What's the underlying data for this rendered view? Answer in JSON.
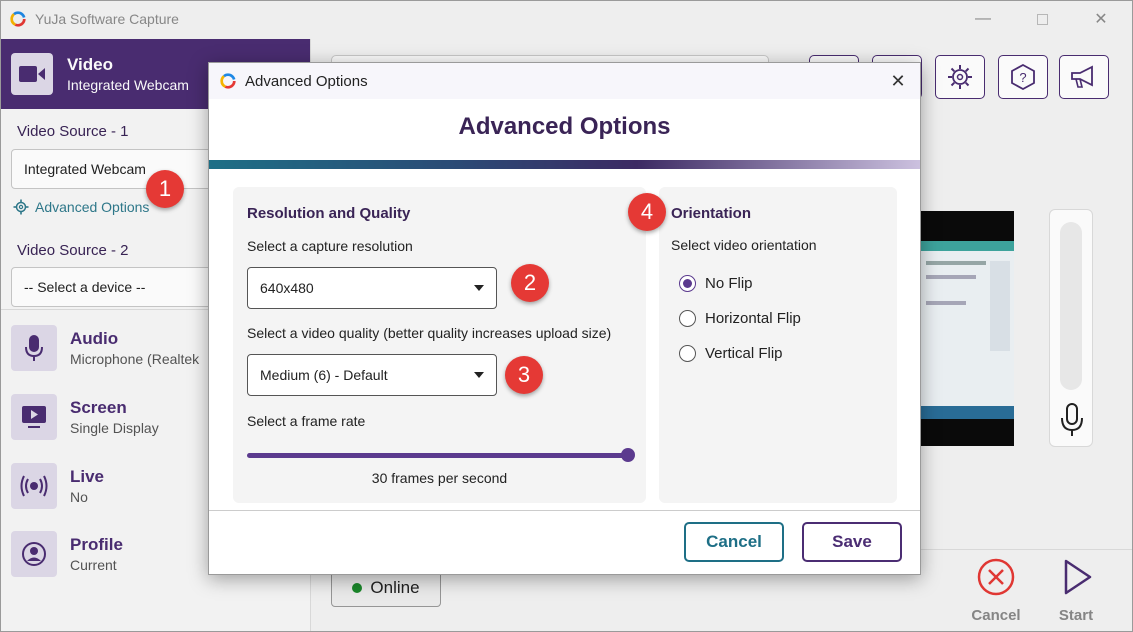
{
  "app": {
    "title": "YuJa Software Capture"
  },
  "sidebar": {
    "video": {
      "title": "Video",
      "subtitle": "Integrated Webcam"
    },
    "source1": {
      "label": "Video Source - 1",
      "value": "Integrated Webcam"
    },
    "advanced_link": "Advanced Options",
    "source2": {
      "label": "Video Source - 2",
      "value": "-- Select a device --"
    },
    "items": [
      {
        "title": "Audio",
        "subtitle": "Microphone (Realtek"
      },
      {
        "title": "Screen",
        "subtitle": "Single Display"
      },
      {
        "title": "Live",
        "subtitle": "No"
      },
      {
        "title": "Profile",
        "subtitle": "Current"
      }
    ]
  },
  "status": {
    "online_label": "Online"
  },
  "bottom_actions": {
    "cancel_label": "Cancel",
    "start_label": "Start"
  },
  "dialog": {
    "window_title": "Advanced Options",
    "heading": "Advanced Options",
    "resolution_quality": {
      "title": "Resolution and Quality",
      "resolution_label": "Select a capture resolution",
      "resolution_value": "640x480",
      "quality_label": "Select a video quality (better quality increases upload size)",
      "quality_value": "Medium (6) - Default",
      "framerate_label": "Select a frame rate",
      "framerate_value": "30 frames per second",
      "framerate_fraction": 1.0
    },
    "orientation": {
      "title": "Orientation",
      "label": "Select video orientation",
      "options": [
        "No Flip",
        "Horizontal Flip",
        "Vertical Flip"
      ],
      "selected": "No Flip"
    },
    "cancel_label": "Cancel",
    "save_label": "Save"
  },
  "annotations": [
    "1",
    "2",
    "3",
    "4"
  ],
  "colors": {
    "brand_purple": "#4b2d73",
    "accent_teal": "#1e6f86",
    "badge_red": "#e53935",
    "online_green": "#1b8a2b"
  }
}
